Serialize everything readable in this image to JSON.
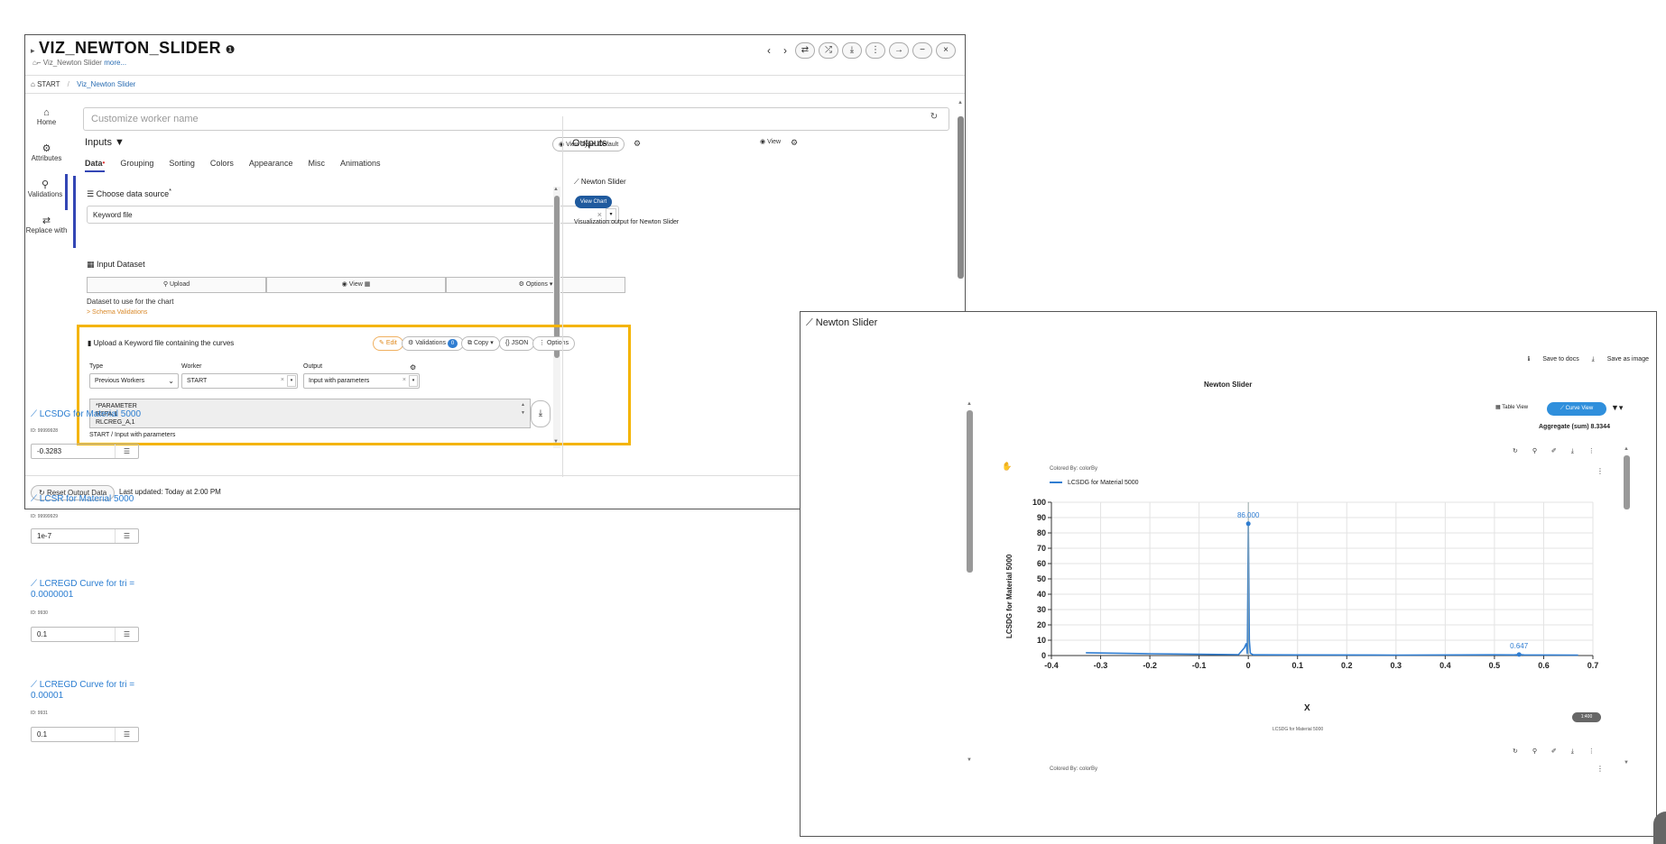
{
  "window": {
    "title": "VIZ_NEWTON_SLIDER",
    "subtitle_path": "Viz_Newton Slider",
    "subtitle_more": "more...",
    "nav_prev": "‹",
    "nav_next": "›",
    "controls": [
      "⇄",
      "⤮",
      "⤓",
      "⋮",
      "→",
      "−",
      "×"
    ]
  },
  "breadcrumb": {
    "home": "START",
    "current": "Viz_Newton Slider"
  },
  "sidenav": [
    {
      "icon": "home-icon",
      "glyph": "⌂",
      "label": "Home"
    },
    {
      "icon": "gear-icon",
      "glyph": "⚙",
      "label": "Attributes"
    },
    {
      "icon": "validations-icon",
      "glyph": "⚲",
      "label": "Validations"
    },
    {
      "icon": "swap-icon",
      "glyph": "⇄",
      "label": "Replace with"
    }
  ],
  "worker_name": {
    "placeholder": "Customize worker name",
    "refresh_icon": "↻"
  },
  "inputs": {
    "heading": "Inputs",
    "view_type": "View Type: Default",
    "tabs": [
      "Data",
      "Grouping",
      "Sorting",
      "Colors",
      "Appearance",
      "Misc",
      "Animations"
    ],
    "data_source": {
      "label": "Choose data source",
      "required": "*",
      "value": "Keyword file"
    },
    "input_dataset": {
      "label": "Input Dataset",
      "buttons": [
        "Upload",
        "View ▦",
        "Options ▾"
      ],
      "note": "Dataset to use for the chart",
      "link": "> Schema Validations"
    },
    "upload": {
      "title": "Upload a Keyword file containing the curves",
      "edit": "Edit",
      "validations": "Validations",
      "validations_count": "0",
      "copy": "Copy ▾",
      "json": "{} JSON",
      "options": "⋮ Options",
      "type_label": "Type",
      "type_value": "Previous Workers",
      "worker_label": "Worker",
      "worker_value": "START",
      "output_label": "Output",
      "output_value": "Input with parameters",
      "params": [
        "*PARAMETER",
        "RSFA,1",
        "RLCREG_A,1"
      ],
      "path": "START / Input with parameters"
    }
  },
  "outputs": {
    "heading": "Outputs",
    "view": "View",
    "item": "Newton Slider",
    "view_chart": "View Chart",
    "desc": "Visualization output for Newton Slider"
  },
  "footer": {
    "reset": "Reset Output Data",
    "updated": "Last updated: Today at 2:00 PM"
  },
  "panel": {
    "title": "Newton Slider",
    "save_docs": "Save to docs",
    "save_image": "Save as image",
    "chart_title": "Newton Slider",
    "table_view": "Table View",
    "curve_view": "Curve View",
    "aggregate": "Aggregate (sum) 8.3344",
    "colored_by": "Colored By: colorBy",
    "zoom": "1:400",
    "params": [
      {
        "label": "LCSDG for Material 5000",
        "id": "ID: 99999928",
        "value": "-0.3283"
      },
      {
        "label": "LCSR for Material 5000",
        "id": "ID: 99999929",
        "value": "1e-7"
      },
      {
        "label": "LCREGD Curve for tri = 0.0000001",
        "id": "ID: 9930",
        "value": "0.1"
      },
      {
        "label": "LCREGD Curve for tri = 0.00001",
        "id": "ID: 9931",
        "value": "0.1"
      }
    ]
  },
  "chart_data": {
    "type": "line",
    "title": "Newton Slider",
    "xlabel": "X",
    "ylabel": "LCSDG for Material 5000",
    "x_caption": "LCSDG for Material 5000",
    "xlim": [
      -0.4,
      0.7
    ],
    "ylim": [
      0,
      100
    ],
    "xticks": [
      -0.4,
      -0.3,
      -0.2,
      -0.1,
      0,
      0.1,
      0.2,
      0.3,
      0.4,
      0.5,
      0.6,
      0.7
    ],
    "yticks": [
      0,
      10,
      20,
      30,
      40,
      50,
      60,
      70,
      80,
      90,
      100
    ],
    "grid": true,
    "legend": "top-left",
    "color": "#2f7dd1",
    "series": [
      {
        "name": "LCSDG for Material 5000",
        "x": [
          -0.33,
          -0.2,
          -0.1,
          -0.02,
          -0.008,
          -0.004,
          -0.002,
          0.0,
          0.002,
          0.004,
          0.01,
          0.1,
          0.3,
          0.5,
          0.54,
          0.55,
          0.56,
          0.67
        ],
        "y": [
          1.8,
          1.2,
          0.8,
          0.6,
          5.0,
          8.0,
          1.0,
          86.0,
          10.0,
          1.5,
          0.5,
          0.4,
          0.3,
          0.5,
          0.4,
          0.647,
          0.4,
          0.3
        ]
      }
    ],
    "annotations": [
      {
        "x": 0.0,
        "y": 86.0,
        "text": "86.000"
      },
      {
        "x": 0.55,
        "y": 0.647,
        "text": "0.647"
      }
    ]
  }
}
